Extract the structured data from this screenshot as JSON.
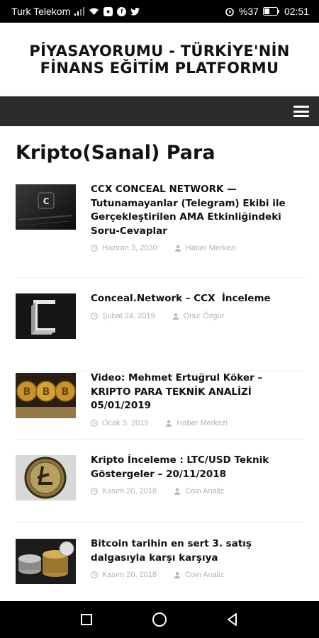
{
  "status_bar": {
    "carrier": "Turk Telekom",
    "battery": "%37",
    "time": "02:51",
    "icons": [
      "signal-icon",
      "wifi-icon",
      "app-icon",
      "facebook-icon",
      "twitter-icon",
      "alarm-icon",
      "battery-icon"
    ]
  },
  "site": {
    "title_line1": "PİYASAYORUMU - TÜRKİYE'NİN",
    "title_line2": "FİNANS EĞİTİM PLATFORMU"
  },
  "page": {
    "title": "Kripto(Sanal) Para"
  },
  "posts": [
    {
      "title": "CCX CONCEAL NETWORK — Tutunamayanlar (Telegram) Ekibi ile Gerçekleştirilen AMA Etkinliğindeki Soru-Cevaplar",
      "date": "Haziran 3, 2020",
      "author": "Haber Merkezi",
      "thumb": "dark-tech"
    },
    {
      "title": "Conceal.Network – CCX  İnceleme",
      "date": "Şubat 24, 2019",
      "author": "Onur Özgür",
      "thumb": "conceal-logo"
    },
    {
      "title": "Video: Mehmet Ertuğrul Köker – KRIPTO PARA TEKNİK ANALİZİ 05/01/2019",
      "date": "Ocak 5, 2019",
      "author": "Haber Merkezi",
      "thumb": "bitcoin-coins"
    },
    {
      "title": "Kripto İnceleme : LTC/USD Teknik Göstergeler – 20/11/2018",
      "date": "Kasım 20, 2018",
      "author": "Coin Analiz",
      "thumb": "litecoin-coin"
    },
    {
      "title": "Bitcoin tarihin en sert 3. satış dalgasıyla karşı karşıya",
      "date": "Kasım 20, 2018",
      "author": "Coin Analiz",
      "thumb": "coin-stacks"
    }
  ],
  "colors": {
    "nav_bar": "#2b2b2b",
    "meta_text": "#b3b3b3",
    "status_bar": "#000000"
  }
}
